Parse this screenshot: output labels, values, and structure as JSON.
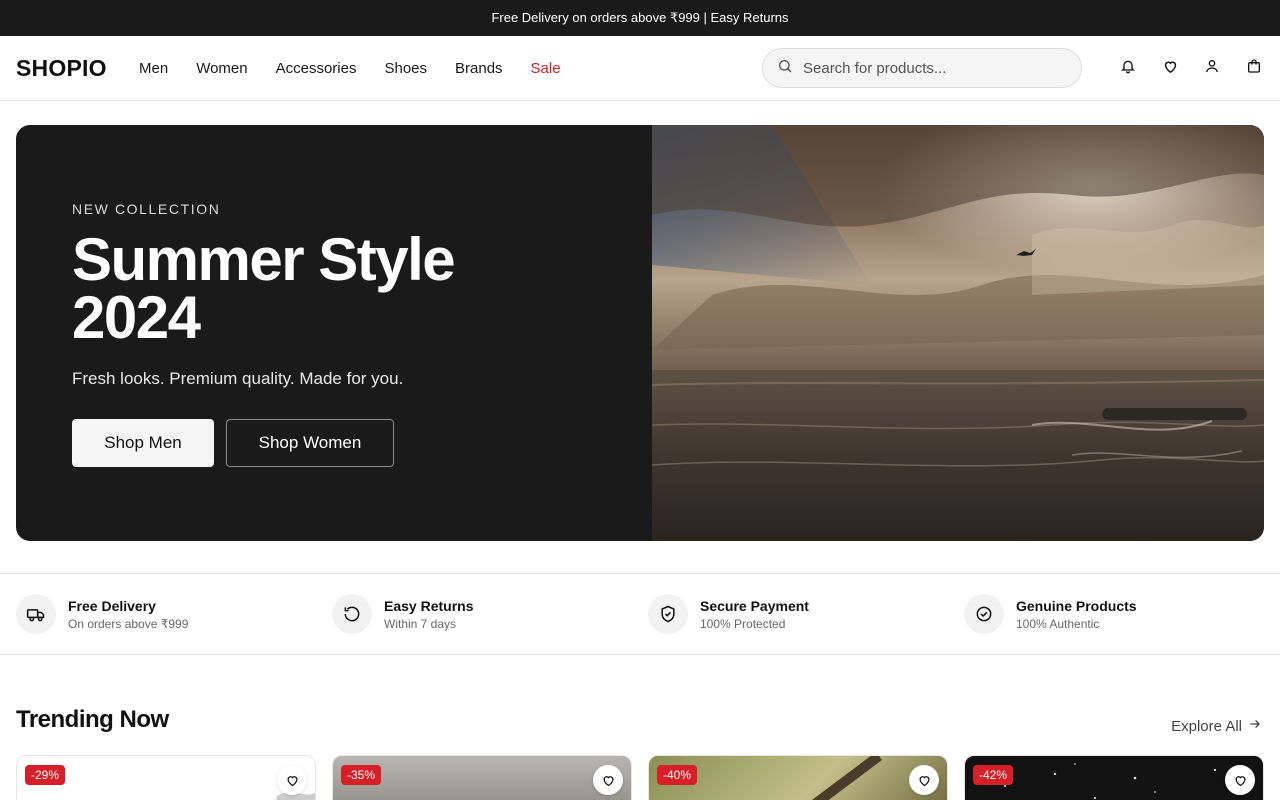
{
  "announcement": "Free Delivery on orders above ₹999 | Easy Returns",
  "header": {
    "logo": "SHOPIO",
    "nav": [
      {
        "label": "Men"
      },
      {
        "label": "Women"
      },
      {
        "label": "Accessories"
      },
      {
        "label": "Shoes"
      },
      {
        "label": "Brands"
      },
      {
        "label": "Sale"
      }
    ],
    "search_placeholder": "Search for products...",
    "icons": [
      "bell-icon",
      "heart-icon",
      "user-icon",
      "bag-icon"
    ]
  },
  "hero": {
    "eyebrow": "NEW COLLECTION",
    "title": "Summer Style 2024",
    "subtitle": "Fresh looks. Premium quality. Made for you.",
    "btn_primary": "Shop Men",
    "btn_secondary": "Shop Women"
  },
  "features": [
    {
      "title": "Free Delivery",
      "sub": "On orders above ₹999",
      "icon": "truck-icon"
    },
    {
      "title": "Easy Returns",
      "sub": "Within 7 days",
      "icon": "rotate-icon"
    },
    {
      "title": "Secure Payment",
      "sub": "100% Protected",
      "icon": "shield-icon"
    },
    {
      "title": "Genuine Products",
      "sub": "100% Authentic",
      "icon": "check-badge-icon"
    }
  ],
  "trending": {
    "title": "Trending Now",
    "explore": "Explore All",
    "cards": [
      {
        "discount": "-29%"
      },
      {
        "discount": "-35%"
      },
      {
        "discount": "-40%"
      },
      {
        "discount": "-42%"
      }
    ]
  },
  "colors": {
    "accent_red": "#d61f26",
    "dark": "#1a1a1a"
  }
}
